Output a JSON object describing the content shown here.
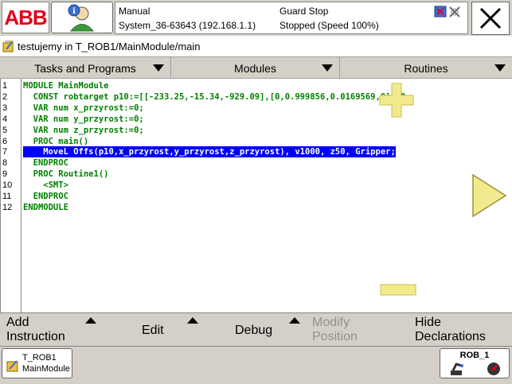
{
  "header": {
    "logo_text": "ABB",
    "mode": "Manual",
    "system": "System_36-63643 (192.168.1.1)",
    "guard": "Guard Stop",
    "state": "Stopped (Speed 100%)"
  },
  "title": "testujemy in T_ROB1/MainModule/main",
  "menus": [
    "Tasks and Programs",
    "Modules",
    "Routines"
  ],
  "code_lines": [
    {
      "n": "1",
      "text": "MODULE MainModule"
    },
    {
      "n": "2",
      "text": "  CONST robtarget p10:=[[-233.25,-15.34,-929.09],[0,0.999856,0.0169569,0],[0,"
    },
    {
      "n": "3",
      "text": "  VAR num x_przyrost:=0;"
    },
    {
      "n": "4",
      "text": "  VAR num y_przyrost:=0;"
    },
    {
      "n": "5",
      "text": "  VAR num z_przyrost:=0;"
    },
    {
      "n": "6",
      "text": "  PROC main()"
    },
    {
      "n": "7",
      "text": "    MoveL Offs(p10,x_przyrost,y_przyrost,z_przyrost), v1000, z50, Gripper;",
      "selected": true
    },
    {
      "n": "8",
      "text": "  ENDPROC"
    },
    {
      "n": "9",
      "text": "  PROC Routine1()"
    },
    {
      "n": "10",
      "text": "    <SMT>"
    },
    {
      "n": "11",
      "text": "  ENDPROC"
    },
    {
      "n": "12",
      "text": "ENDMODULE"
    }
  ],
  "commands": {
    "add_instruction": "Add\nInstruction",
    "edit": "Edit",
    "debug": "Debug",
    "modify_position": "Modify\nPosition",
    "hide_declarations": "Hide\nDeclarations"
  },
  "taskbar": {
    "task_line1": "T_ROB1",
    "task_line2": "MainModule",
    "rob_label": "ROB_1"
  },
  "colors": {
    "code_green": "#008000",
    "selection": "#0000ff",
    "zoom_yellow": "#f2ea8c",
    "abb_red": "#e0001a",
    "chrome_gray": "#d4d0c8"
  }
}
